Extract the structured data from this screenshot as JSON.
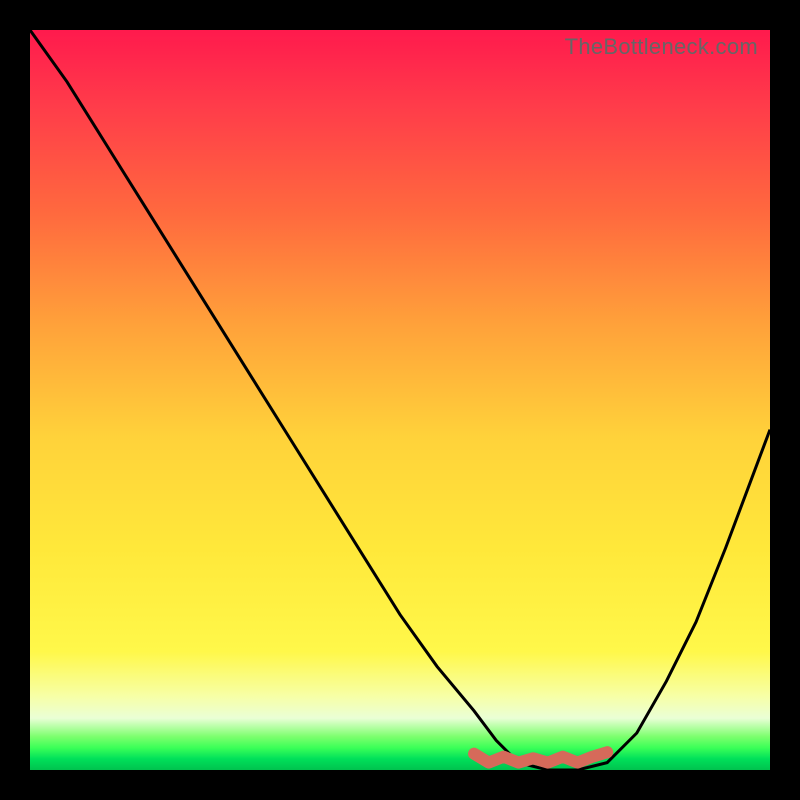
{
  "watermark": "TheBottleneck.com",
  "chart_data": {
    "type": "line",
    "title": "",
    "xlabel": "",
    "ylabel": "",
    "xlim": [
      0,
      100
    ],
    "ylim": [
      0,
      100
    ],
    "grid": false,
    "legend": false,
    "series": [
      {
        "name": "bottleneck-curve",
        "color": "#000000",
        "x": [
          0,
          5,
          10,
          15,
          20,
          25,
          30,
          35,
          40,
          45,
          50,
          55,
          60,
          63,
          66,
          70,
          74,
          78,
          82,
          86,
          90,
          94,
          97,
          100
        ],
        "values": [
          100,
          93,
          85,
          77,
          69,
          61,
          53,
          45,
          37,
          29,
          21,
          14,
          8,
          4,
          1,
          0,
          0,
          1,
          5,
          12,
          20,
          30,
          38,
          46
        ]
      },
      {
        "name": "optimal-range-marker",
        "color": "#d66a5a",
        "x": [
          60,
          62,
          64,
          66,
          68,
          70,
          72,
          74,
          76,
          78
        ],
        "values": [
          2.2,
          1.0,
          1.8,
          1.0,
          1.6,
          1.0,
          1.8,
          1.0,
          1.8,
          2.4
        ]
      }
    ],
    "background_gradient": {
      "top": "#ff1a4d",
      "mid": "#ffd23a",
      "bottom": "#00c24e"
    }
  }
}
